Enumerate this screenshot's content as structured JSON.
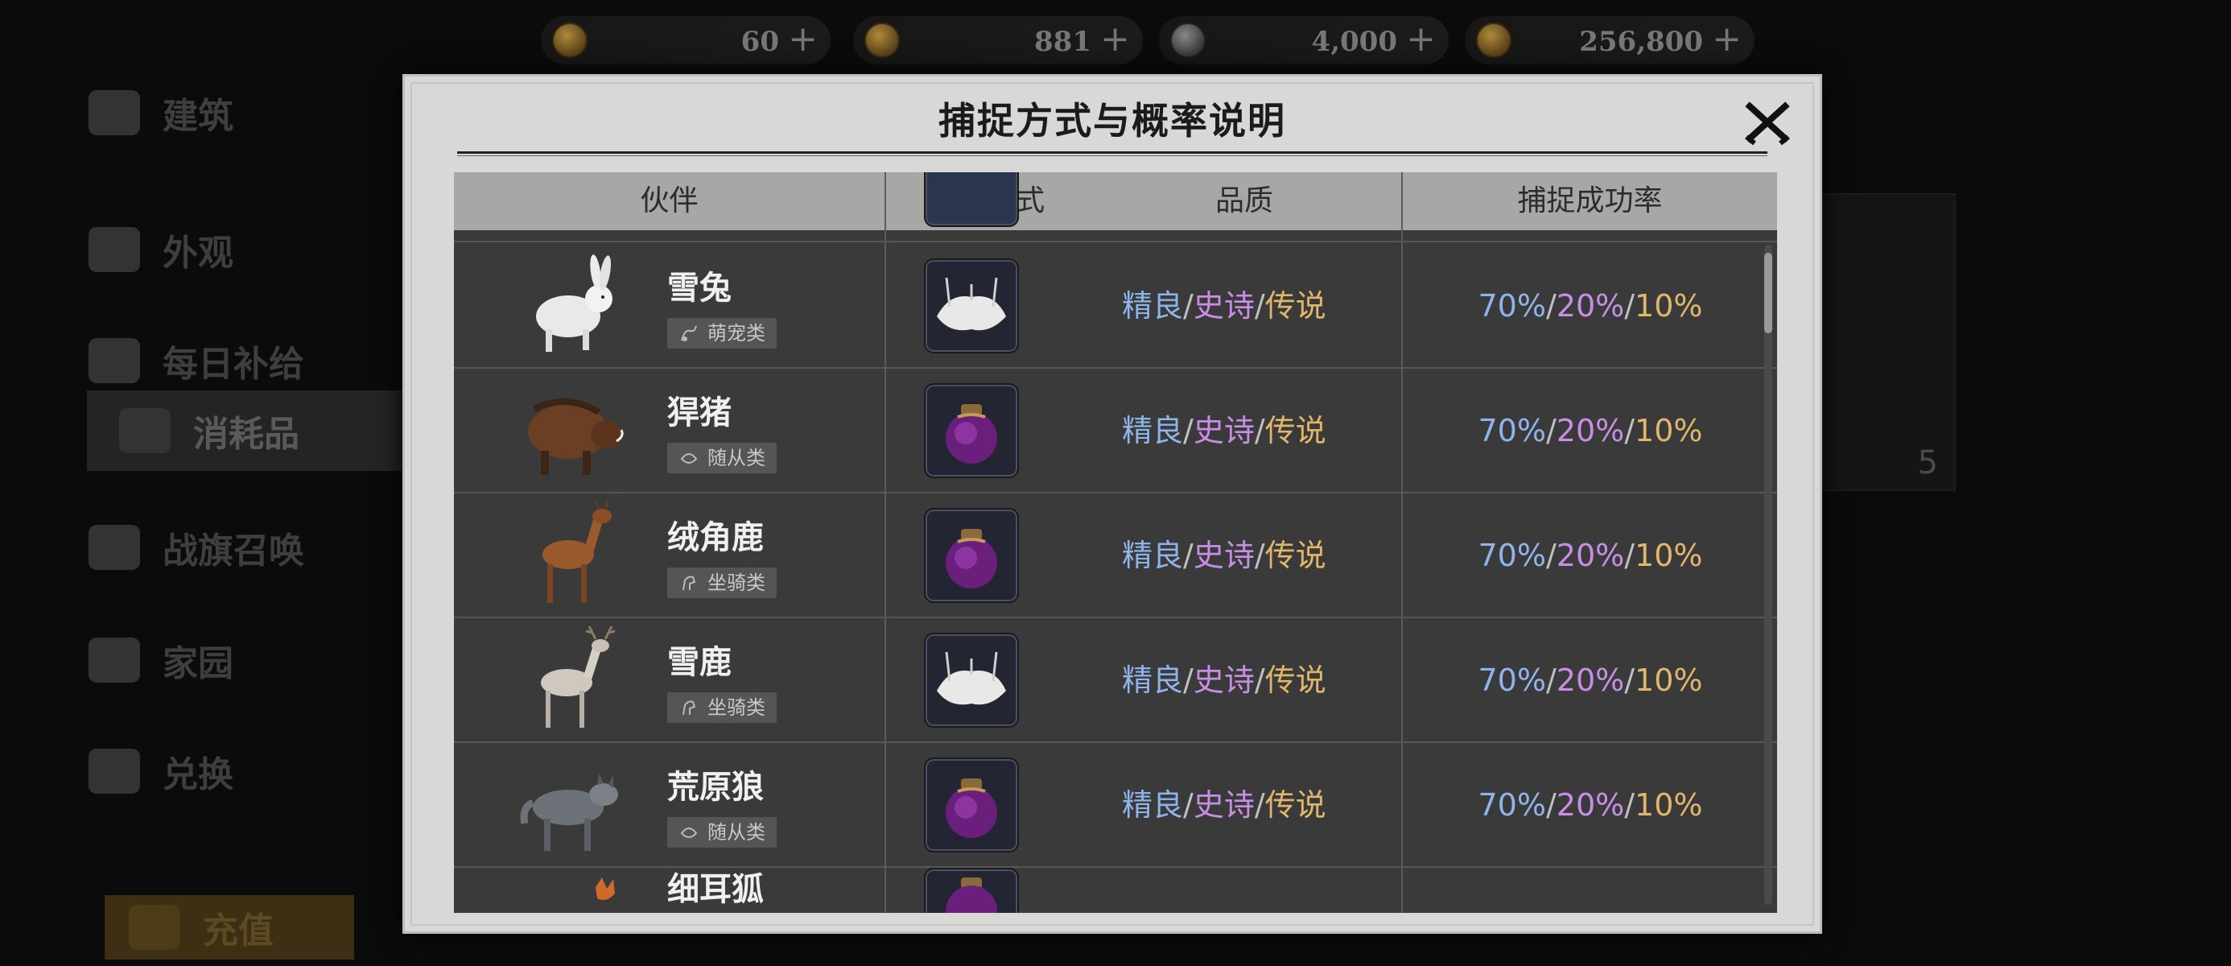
{
  "currencies": [
    {
      "value": "60",
      "icon": "gold-coin-icon",
      "plus": "+"
    },
    {
      "value": "881",
      "icon": "copper-coin-icon",
      "plus": "+"
    },
    {
      "value": "4,000",
      "icon": "silver-coin-icon",
      "plus": "+"
    },
    {
      "value": "256,800",
      "icon": "gold-coin-icon",
      "plus": "+"
    }
  ],
  "background": {
    "sidebar": [
      {
        "label": "建筑"
      },
      {
        "label": "外观"
      },
      {
        "label": "每日补给"
      },
      {
        "label": "消耗品"
      },
      {
        "label": "战旗召唤"
      },
      {
        "label": "家园"
      },
      {
        "label": "兑换"
      },
      {
        "label": "充值"
      }
    ],
    "right_card_number": "5"
  },
  "modal": {
    "title": "捕捉方式与概率说明",
    "close_icon": "close-x-icon",
    "headers": {
      "partner": "伙伴",
      "capture_method": "捕捉方式",
      "quality": "品质",
      "success_rate": "捕捉成功率"
    },
    "rows": [
      {
        "name": "雪兔",
        "category": "萌宠类",
        "category_icon": "pet-icon",
        "item": "white-net-trap",
        "quality": [
          "精良",
          "史诗",
          "传说"
        ],
        "rates": [
          "70%",
          "20%",
          "10%"
        ]
      },
      {
        "name": "猂猪",
        "category": "随从类",
        "category_icon": "follower-icon",
        "item": "purple-capture-pouch",
        "quality": [
          "精良",
          "史诗",
          "传说"
        ],
        "rates": [
          "70%",
          "20%",
          "10%"
        ]
      },
      {
        "name": "绒角鹿",
        "category": "坐骑类",
        "category_icon": "mount-icon",
        "item": "purple-capture-pouch",
        "quality": [
          "精良",
          "史诗",
          "传说"
        ],
        "rates": [
          "70%",
          "20%",
          "10%"
        ]
      },
      {
        "name": "雪鹿",
        "category": "坐骑类",
        "category_icon": "mount-icon",
        "item": "white-net-trap",
        "quality": [
          "精良",
          "史诗",
          "传说"
        ],
        "rates": [
          "70%",
          "20%",
          "10%"
        ]
      },
      {
        "name": "荒原狼",
        "category": "随从类",
        "category_icon": "follower-icon",
        "item": "purple-capture-pouch",
        "quality": [
          "精良",
          "史诗",
          "传说"
        ],
        "rates": [
          "70%",
          "20%",
          "10%"
        ]
      },
      {
        "name": "细耳狐",
        "category": "",
        "category_icon": "",
        "item": "purple-capture-pouch",
        "quality": [
          "",
          "",
          ""
        ],
        "rates": [
          "",
          "",
          ""
        ]
      }
    ],
    "slash": "/",
    "colors": {
      "fine": "#8fb4ea",
      "epic": "#c88ee6",
      "legendary": "#e0b66a"
    }
  }
}
